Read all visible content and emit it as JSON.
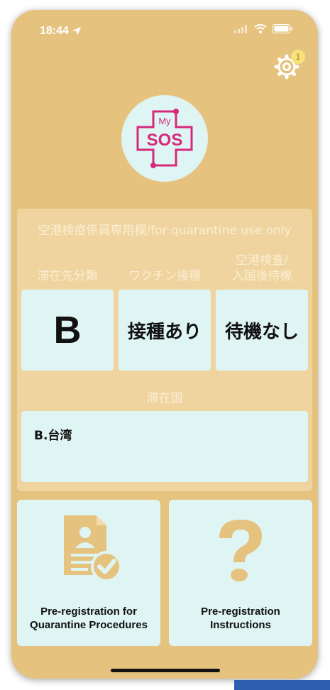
{
  "status_bar": {
    "time": "18:44"
  },
  "header": {
    "settings_badge": "1",
    "logo_top": "My",
    "logo_main": "SOS"
  },
  "quarantine": {
    "title": "空港検疫係員専用欄/for quarantine use only",
    "columns": [
      {
        "label": "滞在先分類",
        "value": "B"
      },
      {
        "label": "ワクチン接種",
        "value": "接種あり"
      },
      {
        "label_line1": "空港検査/",
        "label_line2": "入国後待機",
        "value": "待機なし"
      }
    ],
    "country_label": "滞在国",
    "country_value": "B.台湾"
  },
  "cards": [
    {
      "line1": "Pre-registration for",
      "line2": "Quarantine Procedures",
      "icon": "document-person-check-icon"
    },
    {
      "line1": "Pre-registration",
      "line2": "Instructions",
      "icon": "question-mark-icon"
    }
  ],
  "colors": {
    "background": "#e6c27f",
    "accent": "#dff5f3",
    "logo_pink": "#d6297b",
    "icon_tan": "#e6c27f"
  }
}
